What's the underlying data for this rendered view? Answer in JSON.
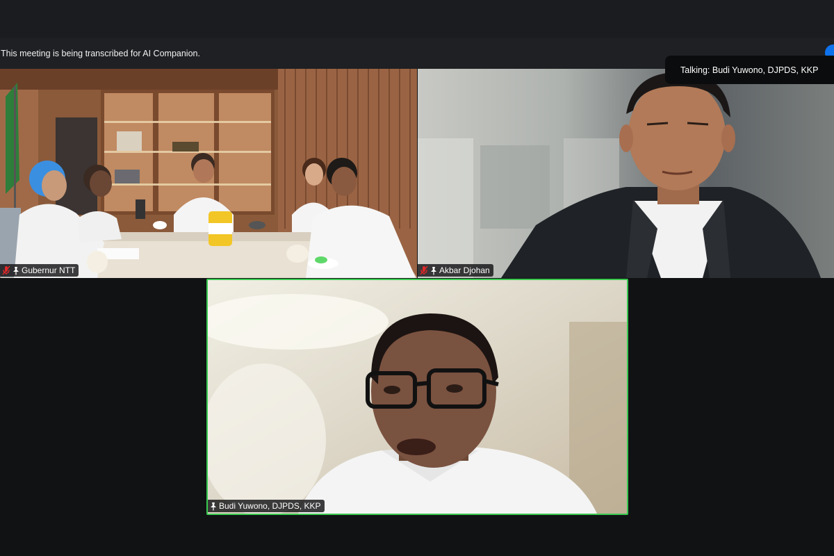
{
  "banner": {
    "text": "This meeting is being transcribed for AI Companion."
  },
  "talking_indicator": "Talking: Budi Yuwono,  DJPDS, KKP",
  "participants": [
    {
      "name": "Gubernur NTT",
      "muted": true,
      "pinned": true
    },
    {
      "name": "Akbar Djohan",
      "muted": true,
      "pinned": true
    },
    {
      "name": "Budi Yuwono,  DJPDS, KKP",
      "muted": false,
      "pinned": true,
      "active_speaker": true
    }
  ],
  "colors": {
    "active_speaker_border": "#38c94e",
    "muted_mic": "#e02828",
    "accent": "#0e72ed"
  }
}
